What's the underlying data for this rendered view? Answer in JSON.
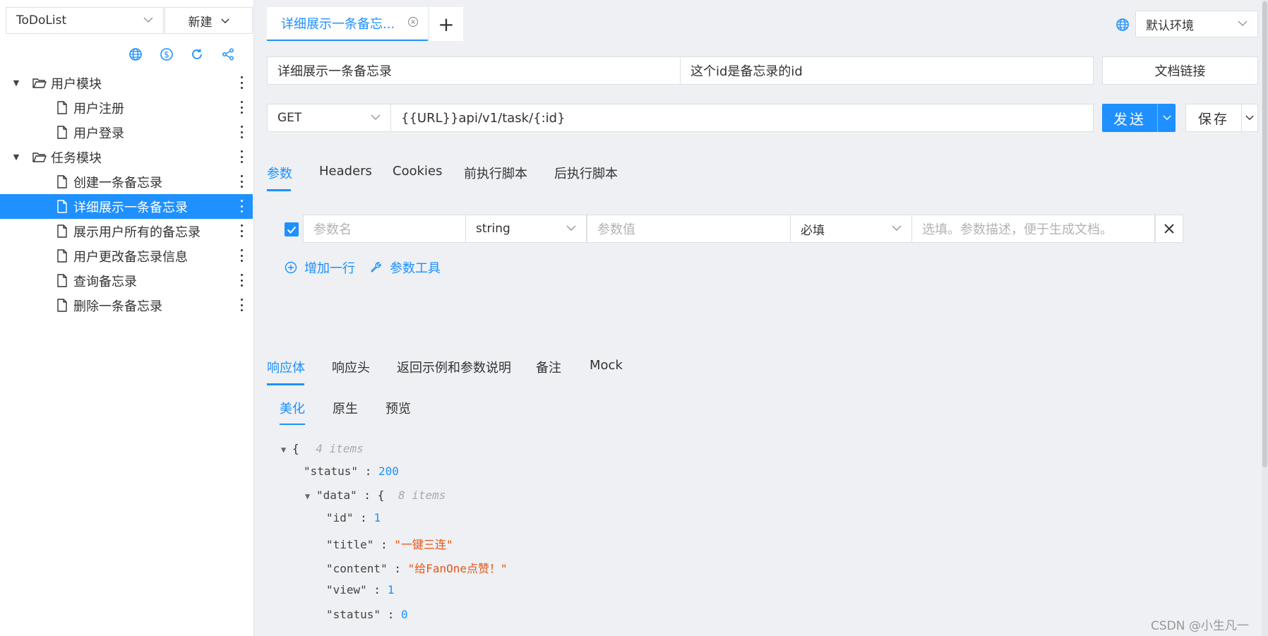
{
  "sidebar": {
    "project_select": "ToDoList",
    "new_button": "新建",
    "tree": [
      {
        "label": "用户模块",
        "type": "folder"
      },
      {
        "label": "用户注册",
        "type": "file"
      },
      {
        "label": "用户登录",
        "type": "file"
      },
      {
        "label": "任务模块",
        "type": "folder"
      },
      {
        "label": "创建一条备忘录",
        "type": "file"
      },
      {
        "label": "详细展示一条备忘录",
        "type": "file",
        "active": true
      },
      {
        "label": "展示用户所有的备忘录",
        "type": "file"
      },
      {
        "label": "用户更改备忘录信息",
        "type": "file"
      },
      {
        "label": "查询备忘录",
        "type": "file"
      },
      {
        "label": "删除一条备忘录",
        "type": "file"
      }
    ]
  },
  "tabs": {
    "open_tab": "详细展示一条备忘...",
    "add_tab": "+"
  },
  "env": {
    "select": "默认环境"
  },
  "request": {
    "name": "详细展示一条备忘录",
    "description": "这个id是备忘录的id",
    "doc_link": "文档链接",
    "method": "GET",
    "url": "{{URL}}api/v1/task/{:id}",
    "send": "发送",
    "save": "保存"
  },
  "req_tabs": [
    "参数",
    "Headers",
    "Cookies",
    "前执行脚本",
    "后执行脚本"
  ],
  "param_row": {
    "name_placeholder": "参数名",
    "type": "string",
    "value_placeholder": "参数值",
    "required": "必填",
    "desc_placeholder": "选填。参数描述，便于生成文档。"
  },
  "param_actions": {
    "add_row": "增加一行",
    "param_tool": "参数工具"
  },
  "resp_tabs": [
    "响应体",
    "响应头",
    "返回示例和参数说明",
    "备注",
    "Mock"
  ],
  "view_tabs": [
    "美化",
    "原生",
    "预览"
  ],
  "json": {
    "root_meta": "4 items",
    "status_key": "\"status\"",
    "status_val": "200",
    "data_key": "\"data\"",
    "data_meta": "8 items",
    "id_key": "\"id\"",
    "id_val": "1",
    "title_key": "\"title\"",
    "title_val": "\"一键三连\"",
    "content_key": "\"content\"",
    "content_val": "\"给FanOne点赞！\"",
    "view_key": "\"view\"",
    "view_val": "1",
    "status2_key": "\"status\"",
    "status2_val": "0"
  },
  "watermark": "CSDN @小生凡一",
  "colors": {
    "accent": "#1e90ff",
    "string": "#e45619"
  }
}
